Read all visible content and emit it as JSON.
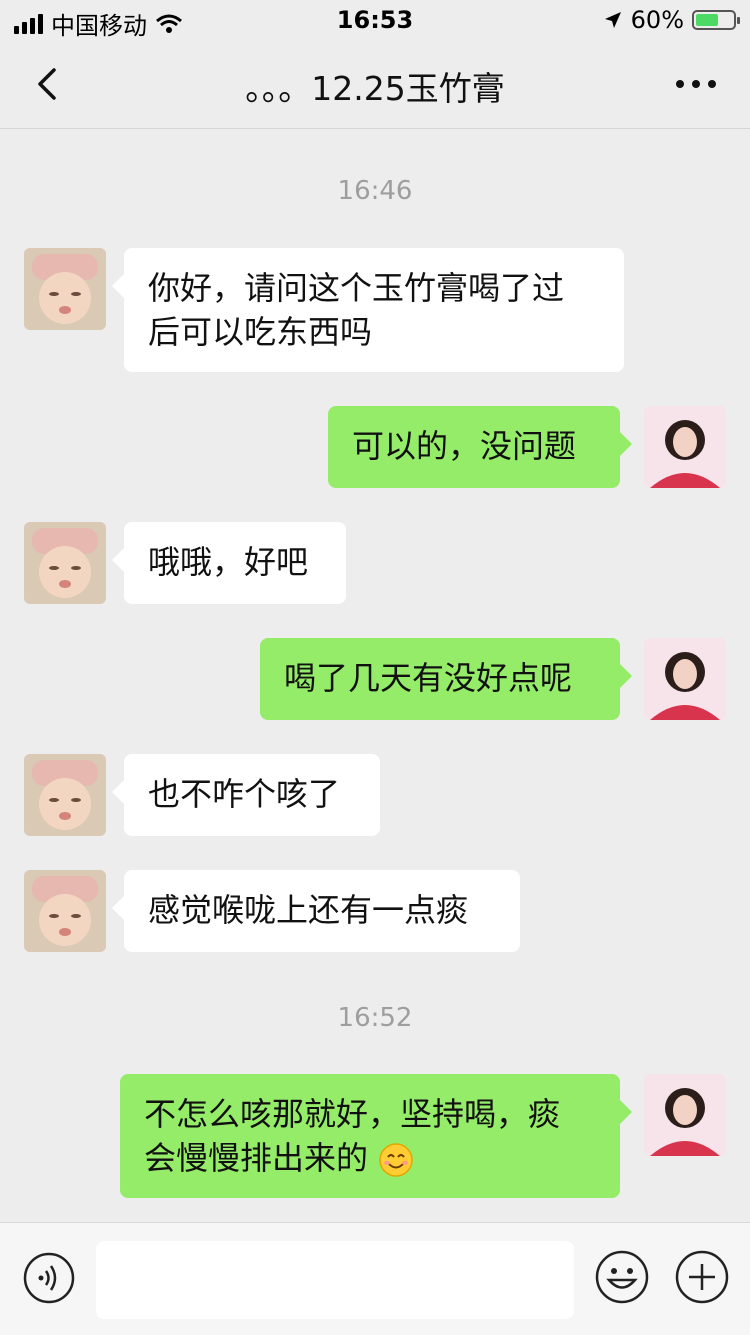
{
  "status_bar": {
    "carrier": "中国移动",
    "time": "16:53",
    "battery": "60%",
    "battery_level": 0.6
  },
  "nav": {
    "title": "。。。12.25玉竹膏"
  },
  "messages": [
    {
      "type": "timestamp",
      "text": "16:46"
    },
    {
      "type": "message",
      "side": "left",
      "lines": [
        "你好，请问这个玉竹膏喝了过",
        "后可以吃东西吗"
      ]
    },
    {
      "type": "message",
      "side": "right",
      "lines": [
        "可以的，没问题"
      ]
    },
    {
      "type": "message",
      "side": "left",
      "lines": [
        "哦哦，好吧"
      ]
    },
    {
      "type": "message",
      "side": "right",
      "lines": [
        "喝了几天有没好点呢"
      ]
    },
    {
      "type": "message",
      "side": "left",
      "lines": [
        "也不咋个咳了"
      ]
    },
    {
      "type": "message",
      "side": "left",
      "lines": [
        "感觉喉咙上还有一点痰"
      ]
    },
    {
      "type": "timestamp",
      "text": "16:52"
    },
    {
      "type": "message",
      "side": "right",
      "lines": [
        "不怎么咳那就好，坚持喝，痰",
        "会慢慢排出来的"
      ],
      "emoji": "smiling-face"
    }
  ],
  "input": {
    "value": "",
    "placeholder": ""
  }
}
